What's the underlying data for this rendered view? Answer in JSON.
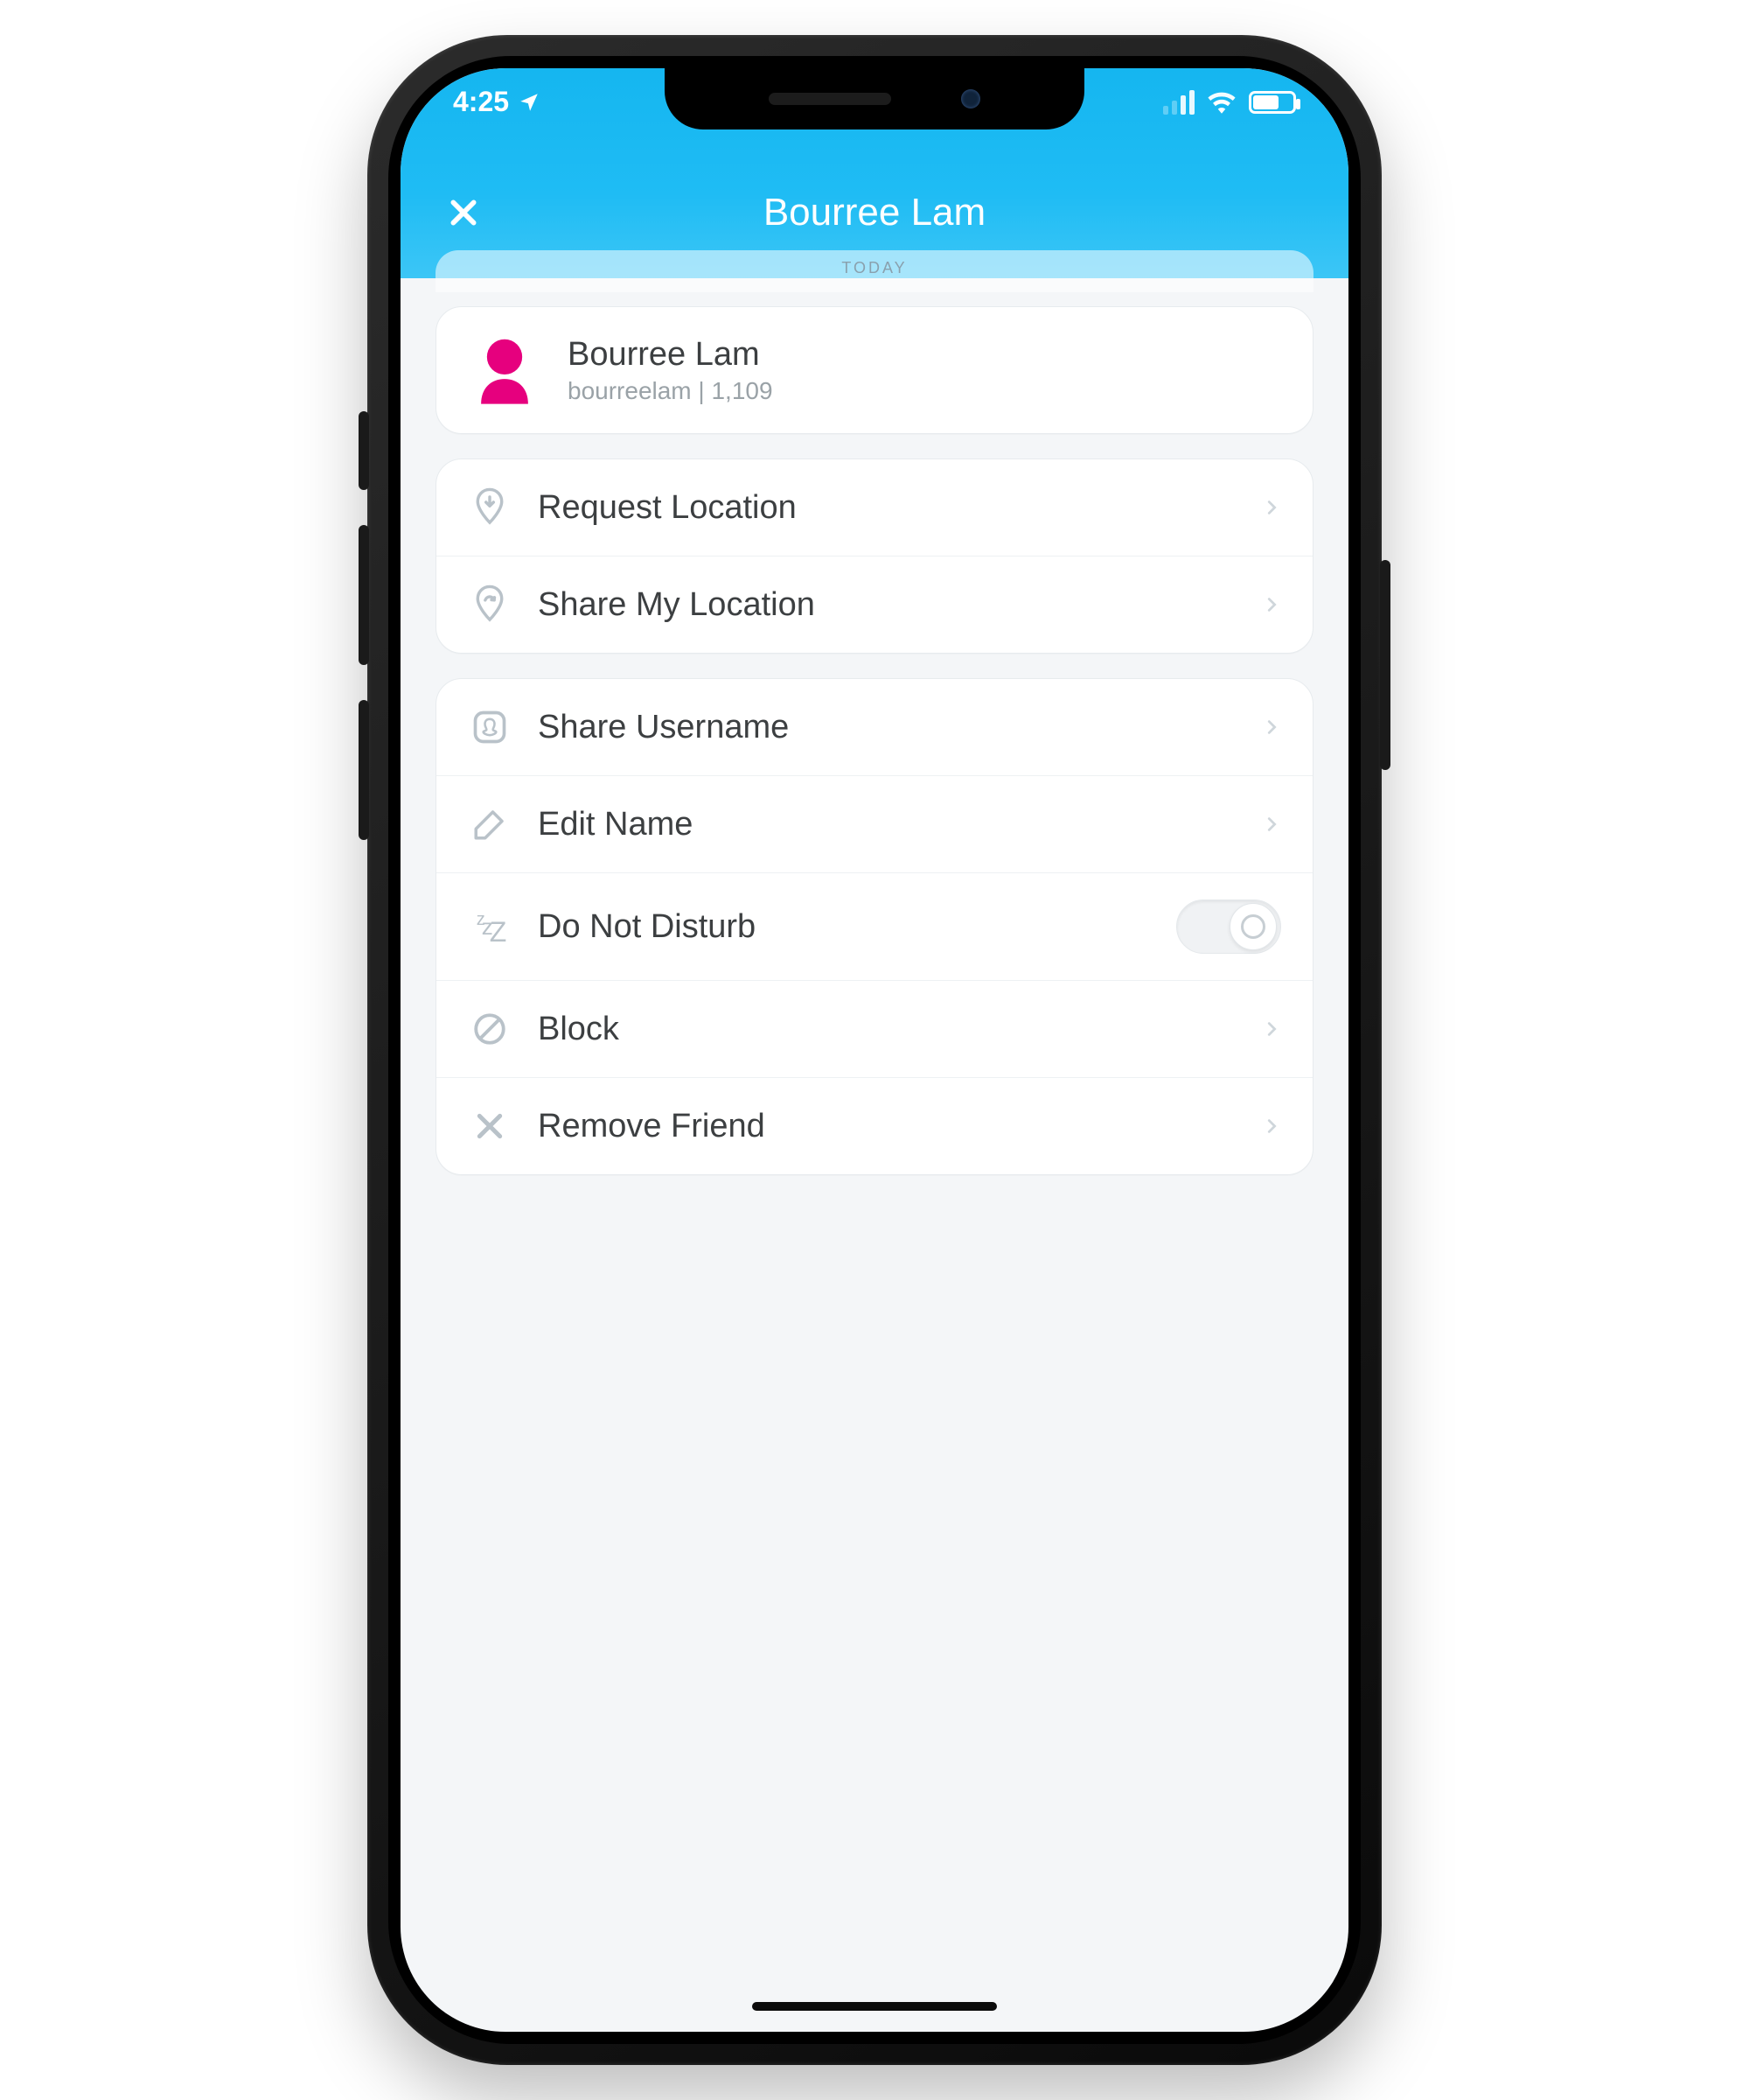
{
  "status": {
    "time": "4:25",
    "location_arrow": "➤"
  },
  "header": {
    "title": "Bourree Lam",
    "today_label": "TODAY"
  },
  "profile": {
    "name": "Bourree Lam",
    "username": "bourreelam",
    "score": "1,109"
  },
  "groups": [
    {
      "rows": [
        {
          "icon": "location-down-icon",
          "label": "Request Location",
          "type": "nav"
        },
        {
          "icon": "location-share-icon",
          "label": "Share My Location",
          "type": "nav"
        }
      ]
    },
    {
      "rows": [
        {
          "icon": "snapcode-icon",
          "label": "Share Username",
          "type": "nav"
        },
        {
          "icon": "pencil-icon",
          "label": "Edit Name",
          "type": "nav"
        },
        {
          "icon": "snooze-icon",
          "label": "Do Not Disturb",
          "type": "toggle",
          "value": false
        },
        {
          "icon": "block-icon",
          "label": "Block",
          "type": "nav"
        },
        {
          "icon": "remove-icon",
          "label": "Remove Friend",
          "type": "nav"
        }
      ]
    }
  ],
  "colors": {
    "accent": "#15b6f0",
    "avatar": "#e6007e",
    "text": "#3c3f41",
    "muted": "#9aa2a7"
  }
}
